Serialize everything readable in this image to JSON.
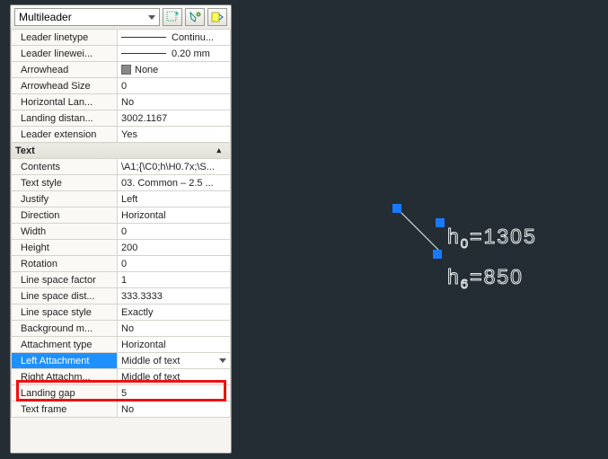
{
  "header": {
    "object_type": "Multileader"
  },
  "groups": {
    "leader_linetype_label": "Leader linetype",
    "leader_linetype_value": "Continu...",
    "leader_lineweight_label": "Leader linewei...",
    "leader_lineweight_value": "0.20 mm",
    "arrowhead_label": "Arrowhead",
    "arrowhead_value": "None",
    "arrowhead_size_label": "Arrowhead Size",
    "arrowhead_size_value": "0",
    "horiz_landing_label": "Horizontal Lan...",
    "horiz_landing_value": "No",
    "landing_dist_label": "Landing distan...",
    "landing_dist_value": "3002.1167",
    "leader_ext_label": "Leader extension",
    "leader_ext_value": "Yes"
  },
  "text_section_title": "Text",
  "text": {
    "contents_label": "Contents",
    "contents_value": "\\A1;{\\C0;h\\H0.7x;\\S...",
    "text_style_label": "Text style",
    "text_style_value": "03. Common – 2.5 ...",
    "justify_label": "Justify",
    "justify_value": "Left",
    "direction_label": "Direction",
    "direction_value": "Horizontal",
    "width_label": "Width",
    "width_value": "0",
    "height_label": "Height",
    "height_value": "200",
    "rotation_label": "Rotation",
    "rotation_value": "0",
    "lsf_label": "Line space factor",
    "lsf_value": "1",
    "lsd_label": "Line space dist...",
    "lsd_value": "333.3333",
    "lss_label": "Line space style",
    "lss_value": "Exactly",
    "bgm_label": "Background m...",
    "bgm_value": "No",
    "att_type_label": "Attachment type",
    "att_type_value": "Horizontal",
    "left_att_label": "Left Attachment",
    "left_att_value": "Middle of text",
    "right_att_label": "Right Attachm...",
    "right_att_value": "Middle of text",
    "landing_gap_label": "Landing gap",
    "landing_gap_value": "5",
    "text_frame_label": "Text frame",
    "text_frame_value": "No"
  },
  "viewport": {
    "line1_prefix": "h",
    "line1_sub": "0",
    "line1_val": "=1305",
    "line2_prefix": "h",
    "line2_sub": "6",
    "line2_val": "=850"
  }
}
